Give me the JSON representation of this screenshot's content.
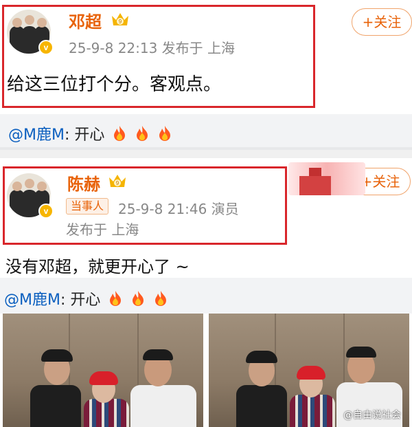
{
  "post1": {
    "author": "邓超",
    "meta": "25-9-8 22:13  发布于 上海",
    "text": "给这三位打个分。客观点。",
    "follow_label": "+关注"
  },
  "quote1": {
    "mention": "@M鹿M",
    "text": ": 开心"
  },
  "post2": {
    "author": "陈赫",
    "tag": "当事人",
    "meta_line1": "25-9-8 21:46  演员",
    "meta_line2": "发布于 上海",
    "text": "没有邓超，就更开心了 ~",
    "follow_label": "+关注"
  },
  "quote2": {
    "mention": "@M鹿M",
    "text": ": 开心"
  },
  "watermark": "@自由说社会",
  "colors": {
    "accent": "#e8630a",
    "highlight_box": "#d9262b",
    "mention": "#0b5fbf",
    "verified": "#f7b500"
  }
}
